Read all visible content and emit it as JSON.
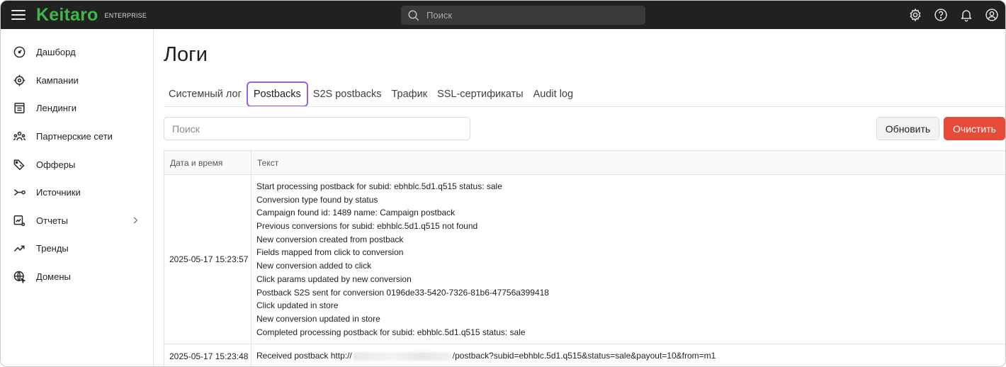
{
  "app": {
    "logo": "Keitaro",
    "edition": "ENTERPRISE",
    "brand_color": "#3fb64a",
    "accent_color": "#9b5de5",
    "danger_color": "#e84a3a"
  },
  "topbar": {
    "search_placeholder": "Поиск",
    "icons": [
      "settings-icon",
      "help-icon",
      "bell-icon",
      "account-icon"
    ]
  },
  "sidebar": {
    "items": [
      {
        "label": "Дашборд",
        "icon": "dashboard-icon"
      },
      {
        "label": "Кампании",
        "icon": "target-icon"
      },
      {
        "label": "Лендинги",
        "icon": "landing-icon"
      },
      {
        "label": "Партнерские сети",
        "icon": "people-icon"
      },
      {
        "label": "Офферы",
        "icon": "tag-icon"
      },
      {
        "label": "Источники",
        "icon": "source-icon"
      },
      {
        "label": "Отчеты",
        "icon": "report-icon",
        "has_submenu": true
      },
      {
        "label": "Тренды",
        "icon": "trend-icon"
      },
      {
        "label": "Домены",
        "icon": "globe-icon"
      }
    ]
  },
  "main": {
    "title": "Логи",
    "tabs": [
      {
        "label": "Системный лог",
        "active": false
      },
      {
        "label": "Postbacks",
        "active": true
      },
      {
        "label": "S2S postbacks",
        "active": false
      },
      {
        "label": "Трафик",
        "active": false
      },
      {
        "label": "SSL-сертификаты",
        "active": false
      },
      {
        "label": "Audit log",
        "active": false
      }
    ],
    "filter_placeholder": "Поиск",
    "refresh_label": "Обновить",
    "clear_label": "Очистить",
    "table": {
      "columns": [
        "Дата и время",
        "Текст"
      ],
      "rows": [
        {
          "datetime": "2025-05-17 15:23:57",
          "messages": [
            "Start processing postback for subid: ebhblc.5d1.q515 status: sale",
            "Conversion type found by status",
            "Campaign found id: 1489 name: Campaign postback",
            "Previous conversions for subid: ebhblc.5d1.q515 not found",
            "New conversion created from postback",
            "Fields mapped from click to conversion",
            "New conversion added to click",
            "Click params updated by new conversion",
            "Postback S2S sent for conversion 0196de33-5420-7326-81b6-47756a399418",
            "Click updated in store",
            "New conversion updated in store",
            "Completed processing postback for subid: ebhblc.5d1.q515 status: sale"
          ]
        },
        {
          "datetime": "2025-05-17 15:23:48",
          "message_prefix": "Received postback http://",
          "message_suffix": "/postback?subid=ebhblc.5d1.q515&status=sale&payout=10&from=m1"
        }
      ]
    }
  }
}
